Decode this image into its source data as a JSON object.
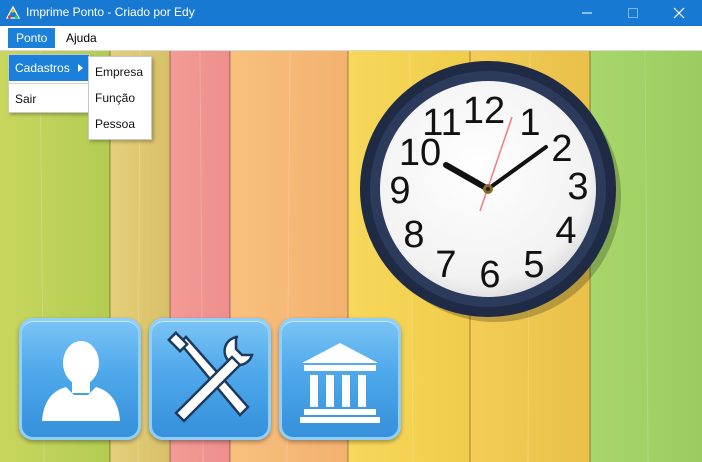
{
  "window": {
    "title": "Imprime Ponto - Criado por Edy",
    "accent": "#1879d2"
  },
  "menubar": {
    "items": [
      {
        "label": "Ponto",
        "active": true
      },
      {
        "label": "Ajuda",
        "active": false
      }
    ]
  },
  "ponto_menu": {
    "items": [
      {
        "label": "Cadastros",
        "has_submenu": true,
        "active": true
      },
      {
        "label": "Sair",
        "has_submenu": false,
        "active": false
      }
    ]
  },
  "cadastros_submenu": {
    "items": [
      {
        "label": "Empresa"
      },
      {
        "label": "Função"
      },
      {
        "label": "Pessoa"
      }
    ]
  },
  "clock": {
    "numbers": [
      "12",
      "1",
      "2",
      "3",
      "4",
      "5",
      "6",
      "7",
      "8",
      "9",
      "10",
      "11"
    ],
    "hour_hand_time": "10:10"
  },
  "shortcut_buttons": [
    {
      "icon": "person-silhouette-icon"
    },
    {
      "icon": "tools-icon"
    },
    {
      "icon": "bank-building-icon"
    }
  ]
}
